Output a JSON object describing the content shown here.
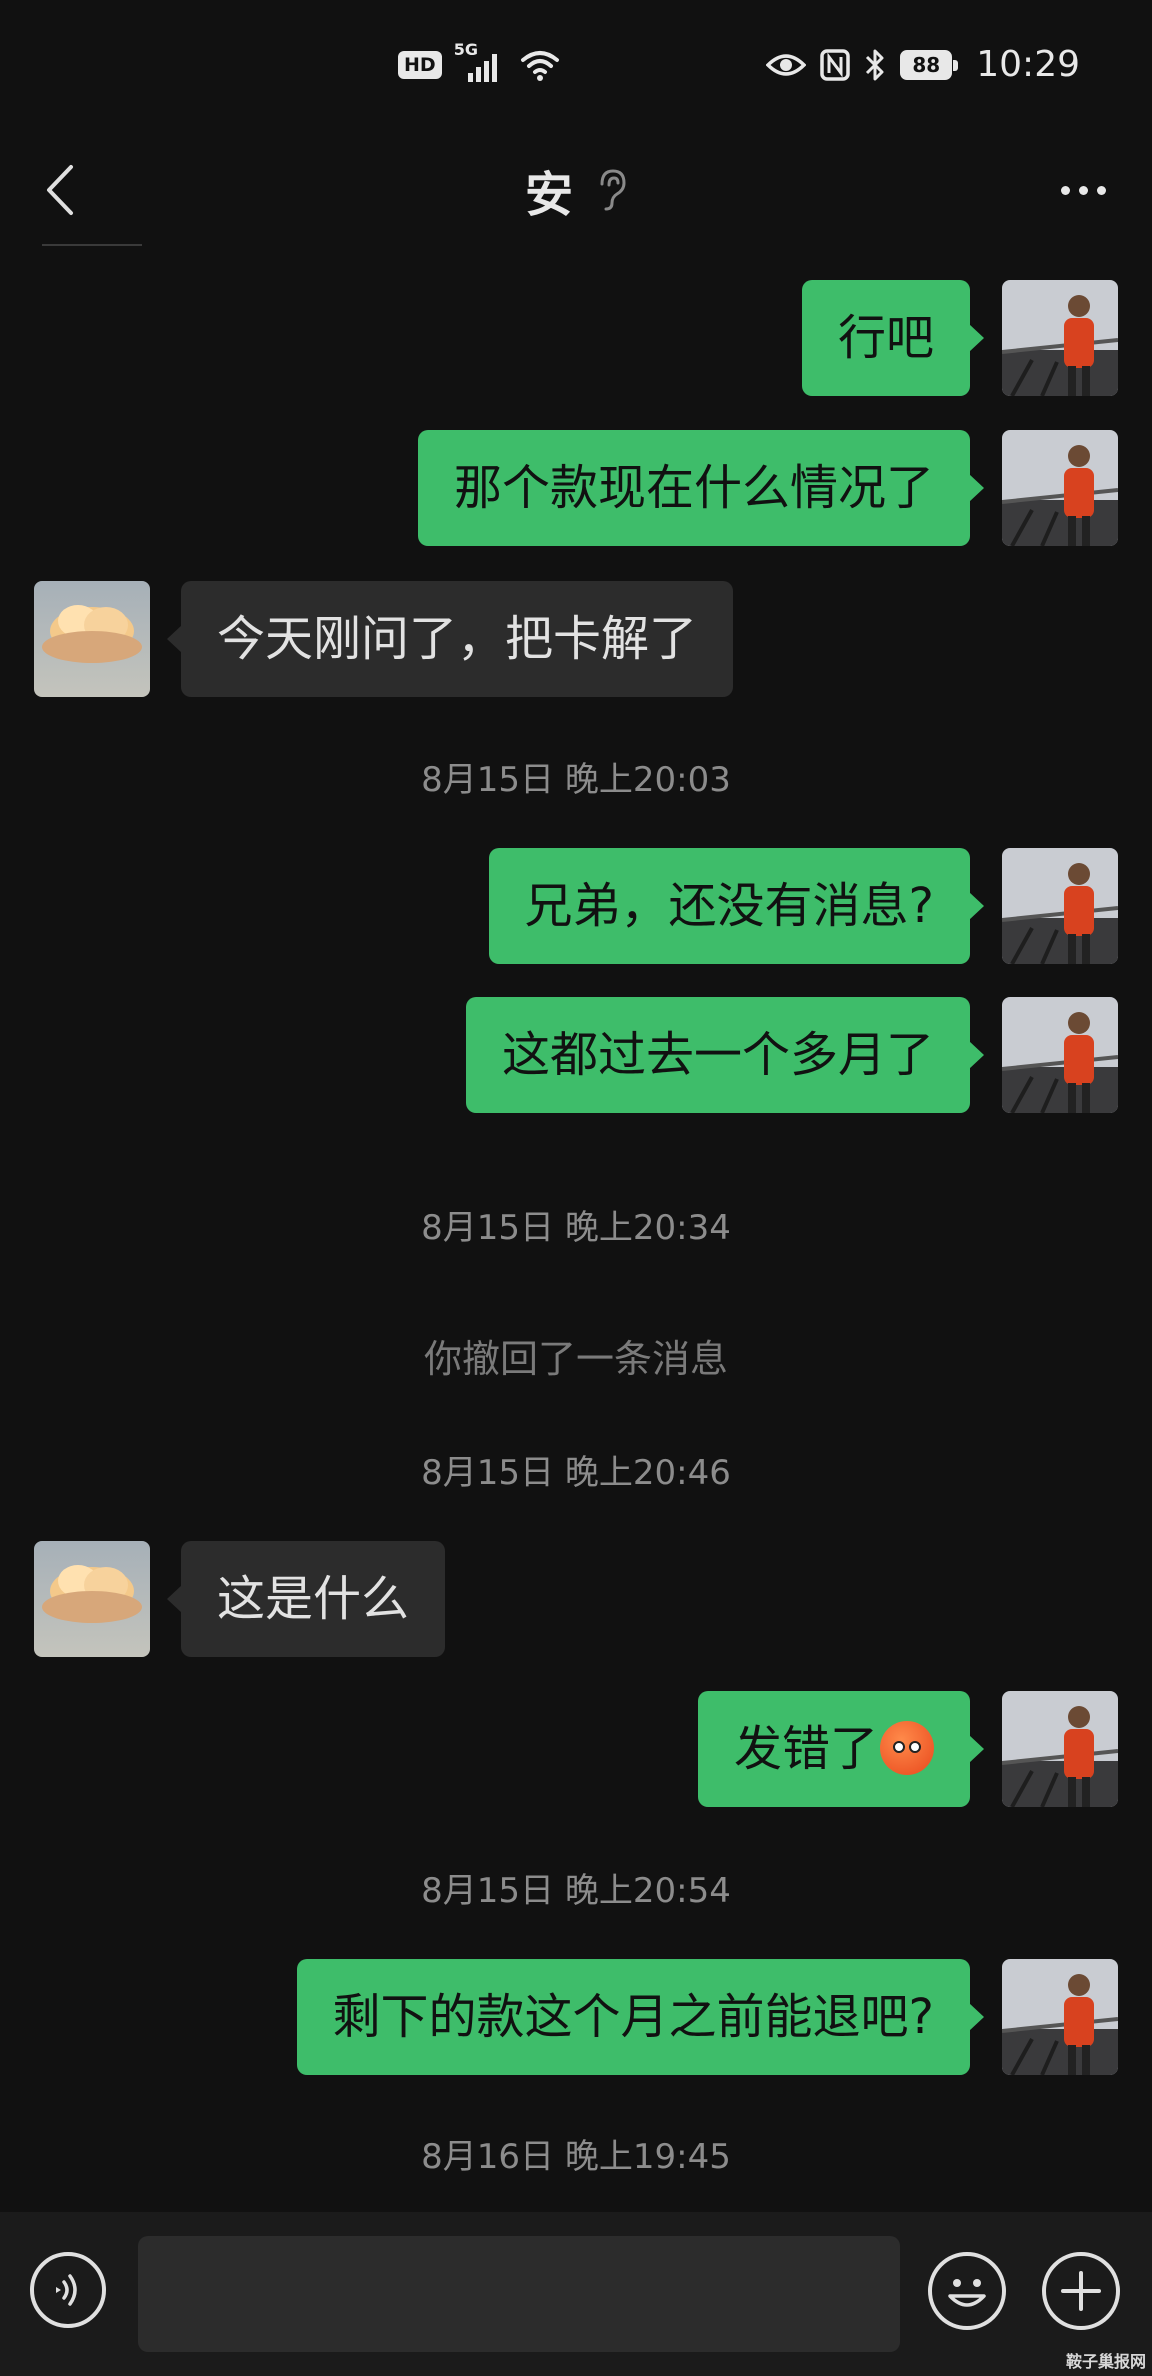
{
  "status_bar": {
    "hd_label": "HD",
    "network_label": "5G",
    "battery": "88",
    "time": "10:29"
  },
  "header": {
    "title": "安",
    "back_icon": "chevron-left-icon",
    "mode_icon": "ear-icon",
    "more_icon": "more-dots-icon"
  },
  "messages": [
    {
      "type": "me",
      "text": "行吧"
    },
    {
      "type": "me",
      "text": "那个款现在什么情况了"
    },
    {
      "type": "them",
      "text": "今天刚问了，把卡解了"
    },
    {
      "type": "time",
      "text": "8月15日 晚上20:03"
    },
    {
      "type": "me",
      "text": "兄弟，还没有消息?"
    },
    {
      "type": "me",
      "text": "这都过去一个多月了"
    },
    {
      "type": "time",
      "text": "8月15日 晚上20:34"
    },
    {
      "type": "system",
      "text": "你撤回了一条消息"
    },
    {
      "type": "time",
      "text": "8月15日 晚上20:46"
    },
    {
      "type": "them",
      "text": "这是什么"
    },
    {
      "type": "me",
      "text": "发错了",
      "emoji": "sad-face-emoji"
    },
    {
      "type": "time",
      "text": "8月15日 晚上20:54"
    },
    {
      "type": "me",
      "text": "剩下的款这个月之前能退吧?"
    },
    {
      "type": "time",
      "text": "8月16日 晚上19:45"
    }
  ],
  "input_bar": {
    "voice_icon": "voice-icon",
    "text_value": "",
    "emoji_icon": "emoji-icon",
    "plus_icon": "plus-icon"
  },
  "watermark": "鞍子巢报网",
  "colors": {
    "background": "#111111",
    "my_bubble": "#3ebd6a",
    "their_bubble": "#2c2c2c",
    "timestamp": "#8c8c8c"
  }
}
